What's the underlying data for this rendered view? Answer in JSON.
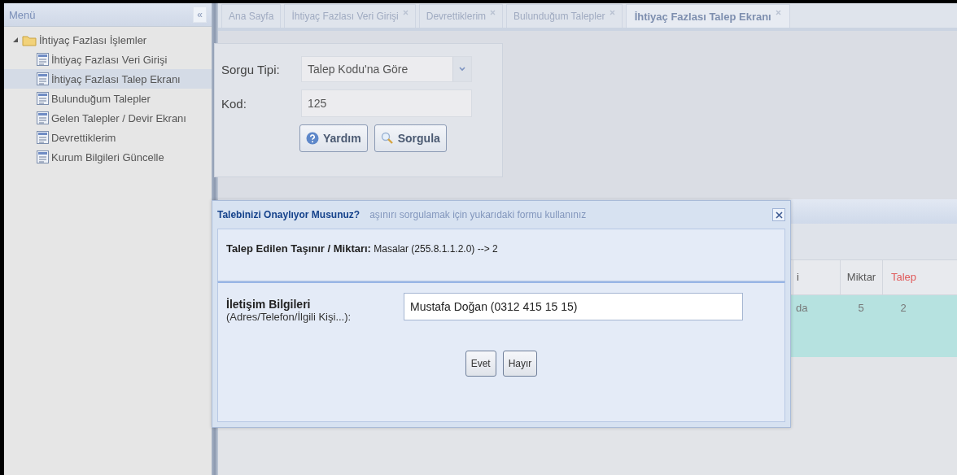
{
  "sidebar": {
    "title": "Menü",
    "collapse": "«",
    "tree": [
      {
        "label": "İhtiyaç Fazlası İşlemler",
        "expanded": true,
        "children": [
          {
            "label": "İhtiyaç Fazlası Veri Girişi",
            "selected": false
          },
          {
            "label": "İhtiyaç Fazlası Talep Ekranı",
            "selected": true
          },
          {
            "label": "Bulunduğum Talepler",
            "selected": false
          },
          {
            "label": "Gelen Talepler / Devir Ekranı",
            "selected": false
          },
          {
            "label": "Devrettiklerim",
            "selected": false
          },
          {
            "label": "Kurum Bilgileri Güncelle",
            "selected": false
          }
        ]
      }
    ]
  },
  "tabs": [
    {
      "label": "Ana Sayfa",
      "selected": false,
      "closable": false
    },
    {
      "label": "İhtiyaç Fazlası Veri Girişi",
      "selected": false,
      "closable": true
    },
    {
      "label": "Devrettiklerim",
      "selected": false,
      "closable": true
    },
    {
      "label": "Bulunduğum Talepler",
      "selected": false,
      "closable": true
    },
    {
      "label": "İhtiyaç Fazlası Talep Ekranı",
      "selected": true,
      "closable": true
    }
  ],
  "query_form": {
    "fields": [
      {
        "kind": "combo",
        "label": "Sorgu Tipi:",
        "value": "Talep Kodu'na Göre"
      },
      {
        "kind": "text",
        "label": "Kod:",
        "value": "125"
      }
    ],
    "buttons": [
      {
        "label": "Yardım"
      },
      {
        "label": "Sorgula"
      }
    ]
  },
  "results_grid": {
    "hint": "aşınırı sorgulamak için yukarıdaki formu kullanınız",
    "columns": [
      {
        "label": "i",
        "highlighted": false
      },
      {
        "label": "Miktar",
        "highlighted": false
      },
      {
        "label": "Talep",
        "highlighted": true
      }
    ],
    "rows": [
      {
        "cells": [
          "da",
          "5",
          "2"
        ],
        "selected": true
      }
    ]
  },
  "dialog": {
    "title": "Talebinizi Onaylıyor Musunuz?",
    "summary": "**Talep Edilen Taşınır / Miktarı:** Masalar (255.8.1.1.2.0) --> 2",
    "contact": {
      "label": "İletişim Bilgileri",
      "sublabel": "(Adres/Telefon/İlgili Kişi...):",
      "value": "Mustafa Doğan (0312 415 15 15)"
    },
    "buttons": [
      "Evet",
      "Hayır"
    ]
  }
}
